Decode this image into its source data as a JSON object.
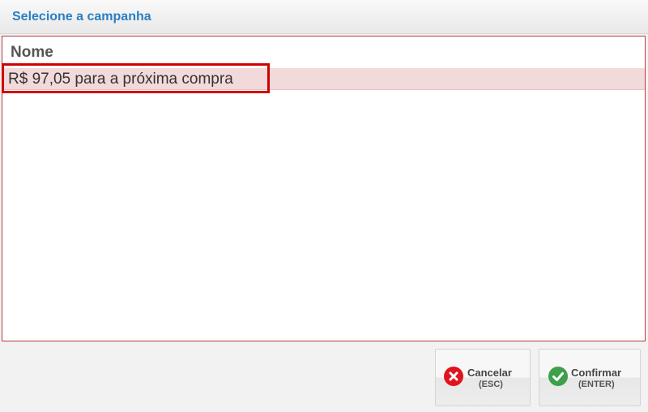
{
  "dialog": {
    "title": "Selecione a campanha"
  },
  "grid": {
    "columns": [
      "Nome"
    ],
    "rows": [
      {
        "nome": "R$ 97,05 para a próxima compra",
        "selected": true
      }
    ]
  },
  "buttons": {
    "cancel": {
      "label": "Cancelar",
      "shortcut": "(ESC)",
      "icon": "close-circle-icon",
      "color": "#e0141e"
    },
    "confirm": {
      "label": "Confirmar",
      "shortcut": "(ENTER)",
      "icon": "check-circle-icon",
      "color": "#3ea04a"
    }
  },
  "colors": {
    "title": "#2a7fc4",
    "selection_row": "#f2d9da",
    "selection_outline": "#d10000"
  }
}
